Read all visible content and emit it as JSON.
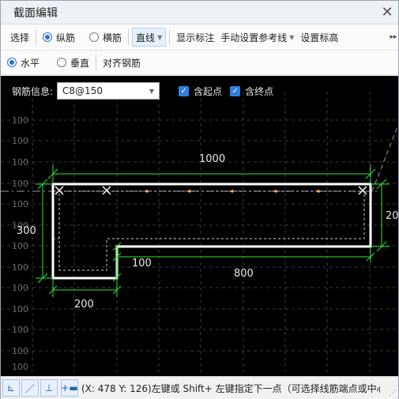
{
  "window": {
    "title": "截面编辑",
    "close_icon": "close-icon"
  },
  "toolbar": {
    "select": "选择",
    "longitudinal": "纵筋",
    "transverse": "横筋",
    "line_mode": "直线",
    "show_dimensions": "显示标注",
    "manual_ref": "手动设置参考线",
    "set_elevation": "设置标高"
  },
  "toolbar2": {
    "horizontal": "水平",
    "vertical": "垂直",
    "align": "对齐钢筋"
  },
  "rebar_info": {
    "label": "钢筋信息:",
    "value": "C8@150",
    "start_label": "含起点",
    "end_label": "含终点"
  },
  "grid_labels": [
    "100",
    "100",
    "100",
    "100",
    "100",
    "100",
    "100",
    "100",
    "100",
    "100",
    "100",
    "100",
    "100"
  ],
  "dimensions": {
    "top": "1000",
    "left": "300",
    "right": "20",
    "step": "100",
    "middle": "800",
    "bottom": "200"
  },
  "status": {
    "text": "(X: 478 Y: 126)左键或 Shift+ 左键指定下一点（可选择线筋端点或中心）"
  },
  "colors": {
    "accent": "#2f7fe0",
    "dimension": "#2ee82e",
    "outline": "#ffffff",
    "canvas": "#000000",
    "guide": "#f0c040"
  }
}
